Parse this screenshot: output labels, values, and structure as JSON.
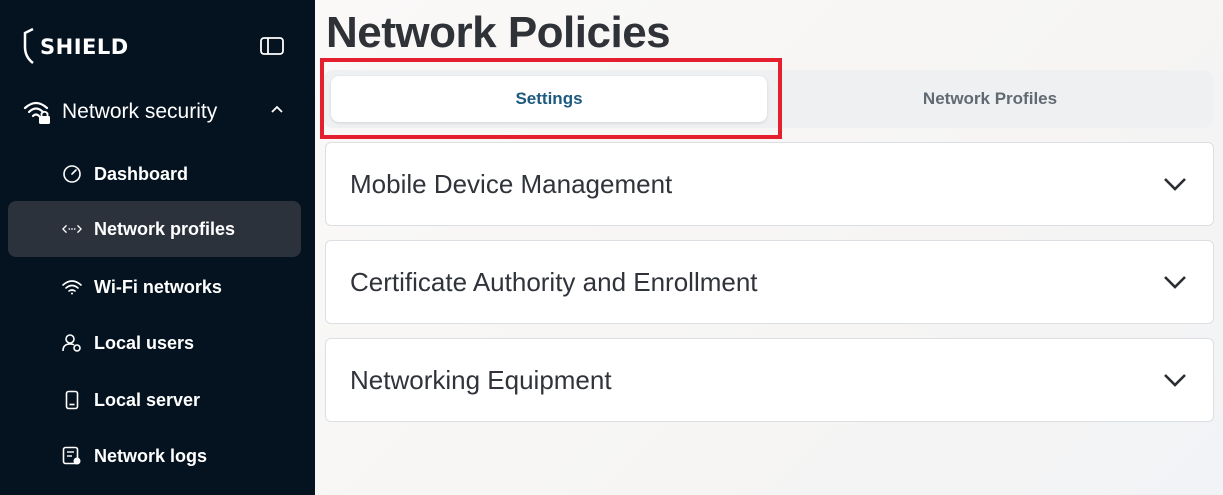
{
  "brand": {
    "name": "SHIELD"
  },
  "sidebar": {
    "section": {
      "label": "Network security",
      "icon": "wifi-lock-icon",
      "expanded": true
    },
    "items": [
      {
        "label": "Dashboard",
        "icon": "speedometer-icon",
        "active": false
      },
      {
        "label": "Network profiles",
        "icon": "code-arrows-icon",
        "active": true
      },
      {
        "label": "Wi-Fi networks",
        "icon": "wifi-icon",
        "active": false
      },
      {
        "label": "Local users",
        "icon": "user-gear-icon",
        "active": false
      },
      {
        "label": "Local server",
        "icon": "server-icon",
        "active": false
      },
      {
        "label": "Network logs",
        "icon": "log-icon",
        "active": false
      }
    ]
  },
  "page": {
    "title": "Network Policies"
  },
  "tabs": [
    {
      "label": "Settings",
      "selected": true
    },
    {
      "label": "Network Profiles",
      "selected": false
    }
  ],
  "accordions": [
    {
      "title": "Mobile Device Management"
    },
    {
      "title": "Certificate Authority and Enrollment"
    },
    {
      "title": "Networking Equipment"
    }
  ],
  "colors": {
    "sidebar_bg": "#05121f",
    "active_item_bg": "#2b323b",
    "selected_tab_text": "#1e5a7f",
    "highlight_border": "#e5202e"
  }
}
